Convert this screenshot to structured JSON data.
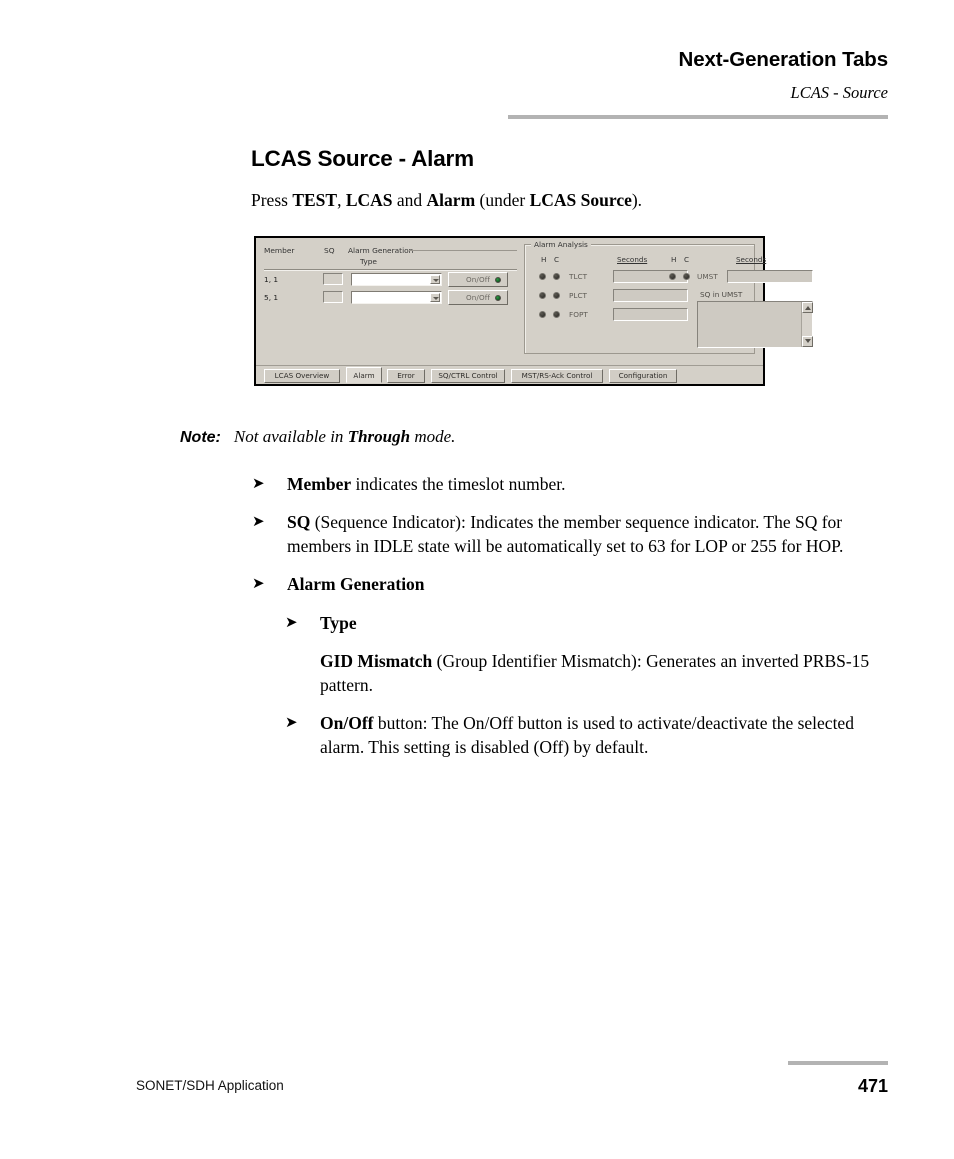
{
  "header": {
    "title": "Next-Generation Tabs",
    "subtitle": "LCAS - Source"
  },
  "section": {
    "title": "LCAS Source - Alarm",
    "intro_prefix": "Press ",
    "intro_b1": "TEST",
    "intro_mid1": ", ",
    "intro_b2": "LCAS",
    "intro_mid2": " and ",
    "intro_b3": "Alarm",
    "intro_mid3": " (under ",
    "intro_b4": "LCAS Source",
    "intro_suffix": ")."
  },
  "figure": {
    "columns": {
      "member": "Member",
      "sq": "SQ",
      "alarm_generation": "Alarm Generation",
      "type": "Type"
    },
    "rows": [
      {
        "member": "1, 1",
        "sq": "",
        "type": "",
        "button": "On/Off",
        "led": "green"
      },
      {
        "member": "5, 1",
        "sq": "",
        "type": "",
        "button": "On/Off",
        "led": "green"
      }
    ],
    "alarm_analysis": {
      "legend": "Alarm Analysis",
      "h_label": "H",
      "c_label": "C",
      "seconds_label": "Seconds",
      "left_rows": [
        {
          "name": "TLCT",
          "seconds": ""
        },
        {
          "name": "PLCT",
          "seconds": ""
        },
        {
          "name": "FOPT",
          "seconds": ""
        }
      ],
      "right_row": {
        "name": "UMST",
        "seconds": ""
      },
      "sq_in_umst_label": "SQ in UMST",
      "sq_in_umst_items": []
    },
    "tabs": [
      {
        "label": "LCAS Overview",
        "active": false
      },
      {
        "label": "Alarm",
        "active": true
      },
      {
        "label": "Error",
        "active": false
      },
      {
        "label": "SQ/CTRL Control",
        "active": false
      },
      {
        "label": "MST/RS-Ack Control",
        "active": false
      },
      {
        "label": "Configuration",
        "active": false
      }
    ]
  },
  "note": {
    "label": "Note:",
    "text_prefix": "Not available in ",
    "text_bold": "Through",
    "text_suffix": " mode."
  },
  "bullets": {
    "arrow": "➤",
    "b1_bold": "Member",
    "b1_text": " indicates the timeslot number.",
    "b2_bold": "SQ",
    "b2_text": " (Sequence Indicator): Indicates the member sequence indicator. The SQ for members in IDLE state will be automatically set to 63 for LOP or 255 for HOP.",
    "b3_bold": "Alarm Generation",
    "b4_bold": "Type",
    "p1_bold": "GID Mismatch",
    "p1_text": " (Group Identifier Mismatch): Generates an inverted PRBS-15 pattern.",
    "b5_bold": "On/Off",
    "b5_text": " button: The On/Off button is used to activate/deactivate the selected alarm. This setting is disabled (Off) by default."
  },
  "footer": {
    "left": "SONET/SDH Application",
    "page": "471"
  }
}
